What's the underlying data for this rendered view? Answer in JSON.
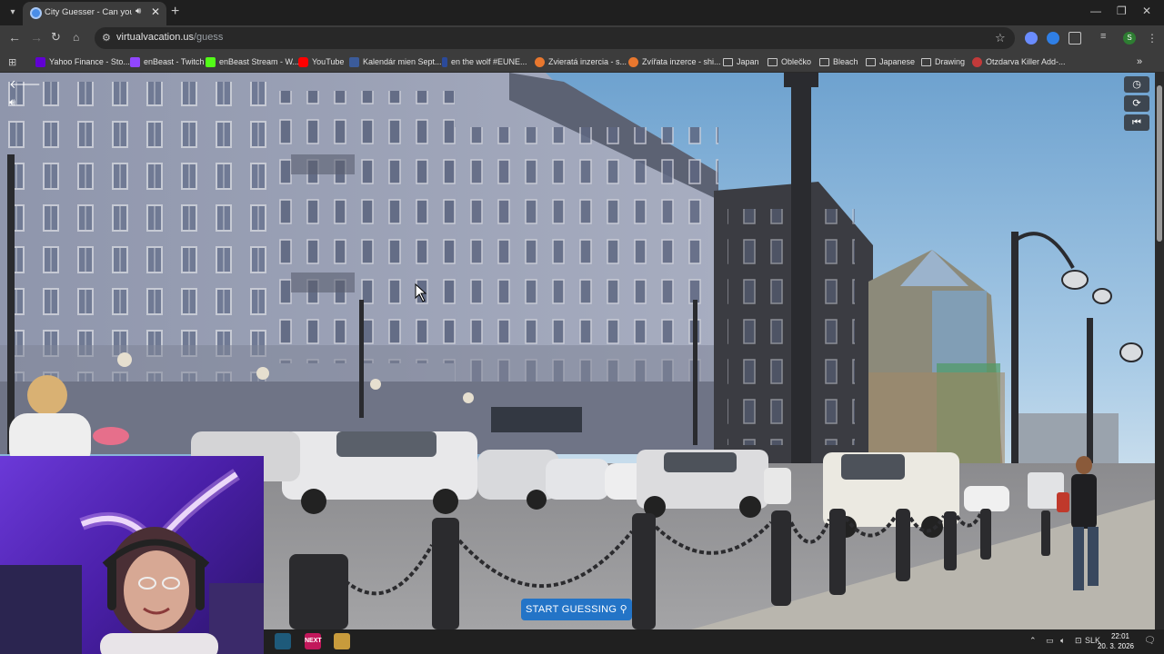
{
  "browser": {
    "tab": {
      "title": "City Guesser - Can you gue"
    },
    "url": {
      "domain": "virtualvacation.us",
      "path": "/guess"
    },
    "bookmarks": [
      {
        "label": "Yahoo Finance - Sto...",
        "icon": "yahoo-icon",
        "color": "#6001d2"
      },
      {
        "label": "enBeast - Twitch",
        "icon": "twitch-icon",
        "color": "#9146ff"
      },
      {
        "label": "enBeast Stream - W...",
        "icon": "kick-icon",
        "color": "#53fc18"
      },
      {
        "label": "YouTube",
        "icon": "youtube-icon",
        "color": "#ff0000"
      },
      {
        "label": "Kalendár mien Sept...",
        "icon": "calendar-icon",
        "color": "#3b5b9a"
      },
      {
        "label": "en the wolf #EUNE...",
        "icon": "game-icon",
        "color": "#2b4a9a"
      },
      {
        "label": "Zvieratá inzercia - s...",
        "icon": "bazos-icon",
        "color": "#e8772e"
      },
      {
        "label": "Zvířata inzerce - shi...",
        "icon": "bazos-icon",
        "color": "#e8772e"
      },
      {
        "label": "Japan",
        "icon": "folder-icon"
      },
      {
        "label": "Oblečko",
        "icon": "folder-icon"
      },
      {
        "label": "Bleach",
        "icon": "folder-icon"
      },
      {
        "label": "Japanese",
        "icon": "folder-icon"
      },
      {
        "label": "Drawing",
        "icon": "folder-icon"
      },
      {
        "label": "Otzdarva Killer Add-...",
        "icon": "killer-icon",
        "color": "#c23a3a"
      }
    ]
  },
  "game": {
    "start_button": "START GUESSING",
    "controls": [
      "back-arrow-icon",
      "volume-icon",
      "timer-icon",
      "refresh-icon",
      "skip-back-icon"
    ]
  },
  "taskbar": {
    "apps": [
      {
        "label": "",
        "icon": "terminal-icon",
        "color": "#1e5a7a"
      },
      {
        "label": "NEXT",
        "icon": "next-app-icon",
        "color": "#c2185b"
      },
      {
        "label": "",
        "icon": "league-icon",
        "color": "#c89b3c"
      }
    ],
    "language": "SLK",
    "time": "22:01",
    "date": "20. 3. 2026"
  }
}
